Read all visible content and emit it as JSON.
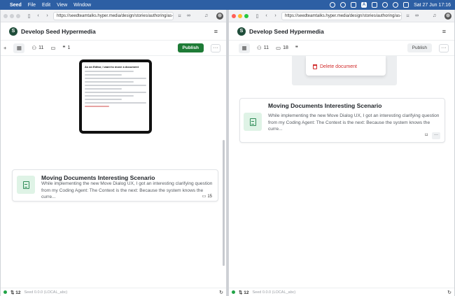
{
  "menubar": {
    "app": "Seed",
    "items": [
      "File",
      "Edit",
      "View",
      "Window"
    ],
    "clock": "Sat 27 Jun  17:16"
  },
  "left_window": {
    "url": "https://seedteamtalks.hyper.media/design/stories/authoring/as-...",
    "site_title": "Develop Seed Hypermedia",
    "toolbar": {
      "collaborators_count": "11",
      "publish_label": "Publish"
    },
    "preview": {
      "title": "As an Editor, I want to move a document"
    },
    "card": {
      "title": "Moving Documents Interesting Scenario",
      "description": "While implementing the new Move Dialog UX, I got an interesting clarifying question from my Coding Agent: The Context is the next: Because the system knows the curre...",
      "comment_count": "15"
    },
    "status": {
      "sync_count": "12",
      "version": "Seed 0.0.0 (LOCAL_abc)"
    }
  },
  "right_window": {
    "url": "https://seedteamtalks.hyper.media/design/stories/authoring/as-...",
    "site_title": "Develop Seed Hypermedia",
    "toolbar": {
      "collaborators_count": "11",
      "comments_count": "18",
      "publish_label": "Publish"
    },
    "context_menu": {
      "delete_label": "Delete document"
    },
    "card": {
      "title": "Moving Documents Interesting Scenario",
      "description": "While implementing the new Move Dialog UX, I got an interesting clarifying question from my Coding Agent: The Context is the next: Because the system knows the curre..."
    },
    "status": {
      "sync_count": "12",
      "version": "Seed 0.0.0 (LOCAL_abc)"
    }
  },
  "colors": {
    "menubar": "#2d5fa4",
    "publish_green": "#1e7b36",
    "doc_thumb": "#dff3e6",
    "danger": "#d12c2c"
  }
}
